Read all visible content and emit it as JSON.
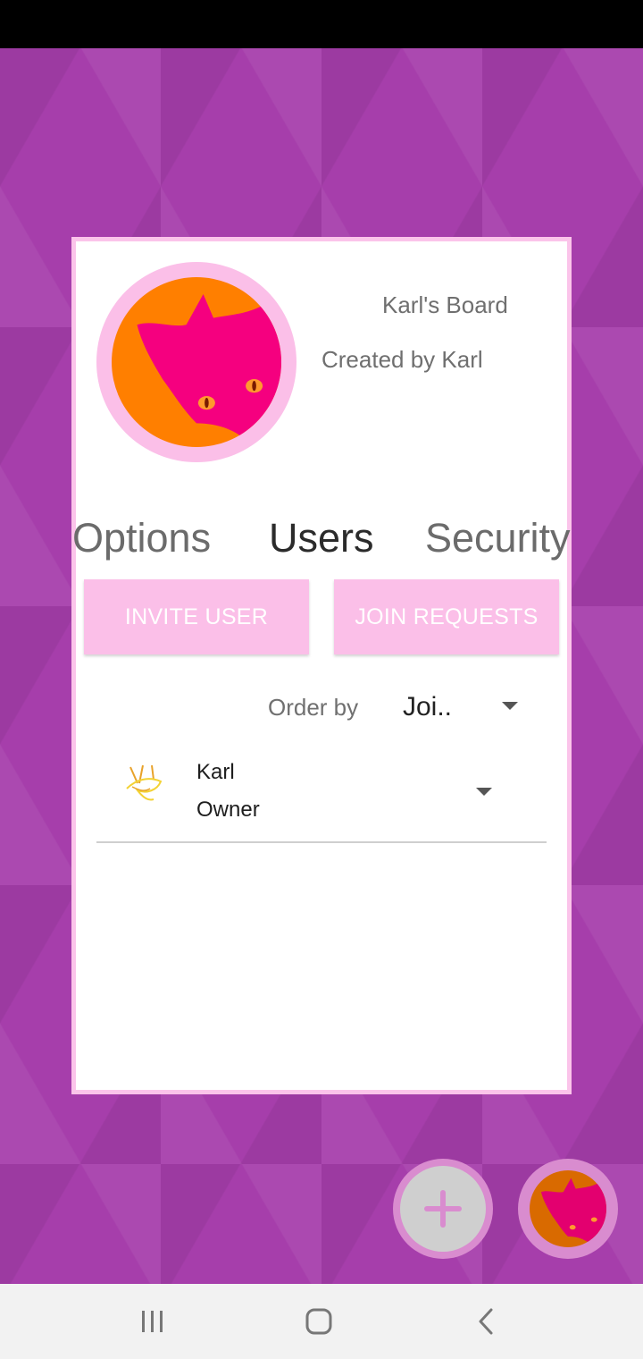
{
  "board": {
    "title": "Karl's Board",
    "creator": "Created by Karl"
  },
  "tabs": [
    {
      "label": "Options",
      "active": false
    },
    {
      "label": "Users",
      "active": true
    },
    {
      "label": "Security",
      "active": false
    }
  ],
  "actions": {
    "invite_label": "INVITE USER",
    "join_label": "JOIN REQUESTS"
  },
  "order": {
    "label": "Order by",
    "value": "Joi.."
  },
  "users": [
    {
      "name": "Karl",
      "role": "Owner"
    }
  ],
  "icons": {
    "board_avatar": "cat-avatar-icon",
    "user_avatar": "sketch-avatar-icon",
    "add": "plus-icon",
    "profile": "cat-avatar-icon",
    "recents": "recents-icon",
    "home": "home-icon",
    "back": "back-icon"
  },
  "colors": {
    "accent": "#fbbfe8",
    "background": "#a63eab",
    "avatar_orange": "#ff7f00",
    "avatar_pink": "#f5007f"
  }
}
